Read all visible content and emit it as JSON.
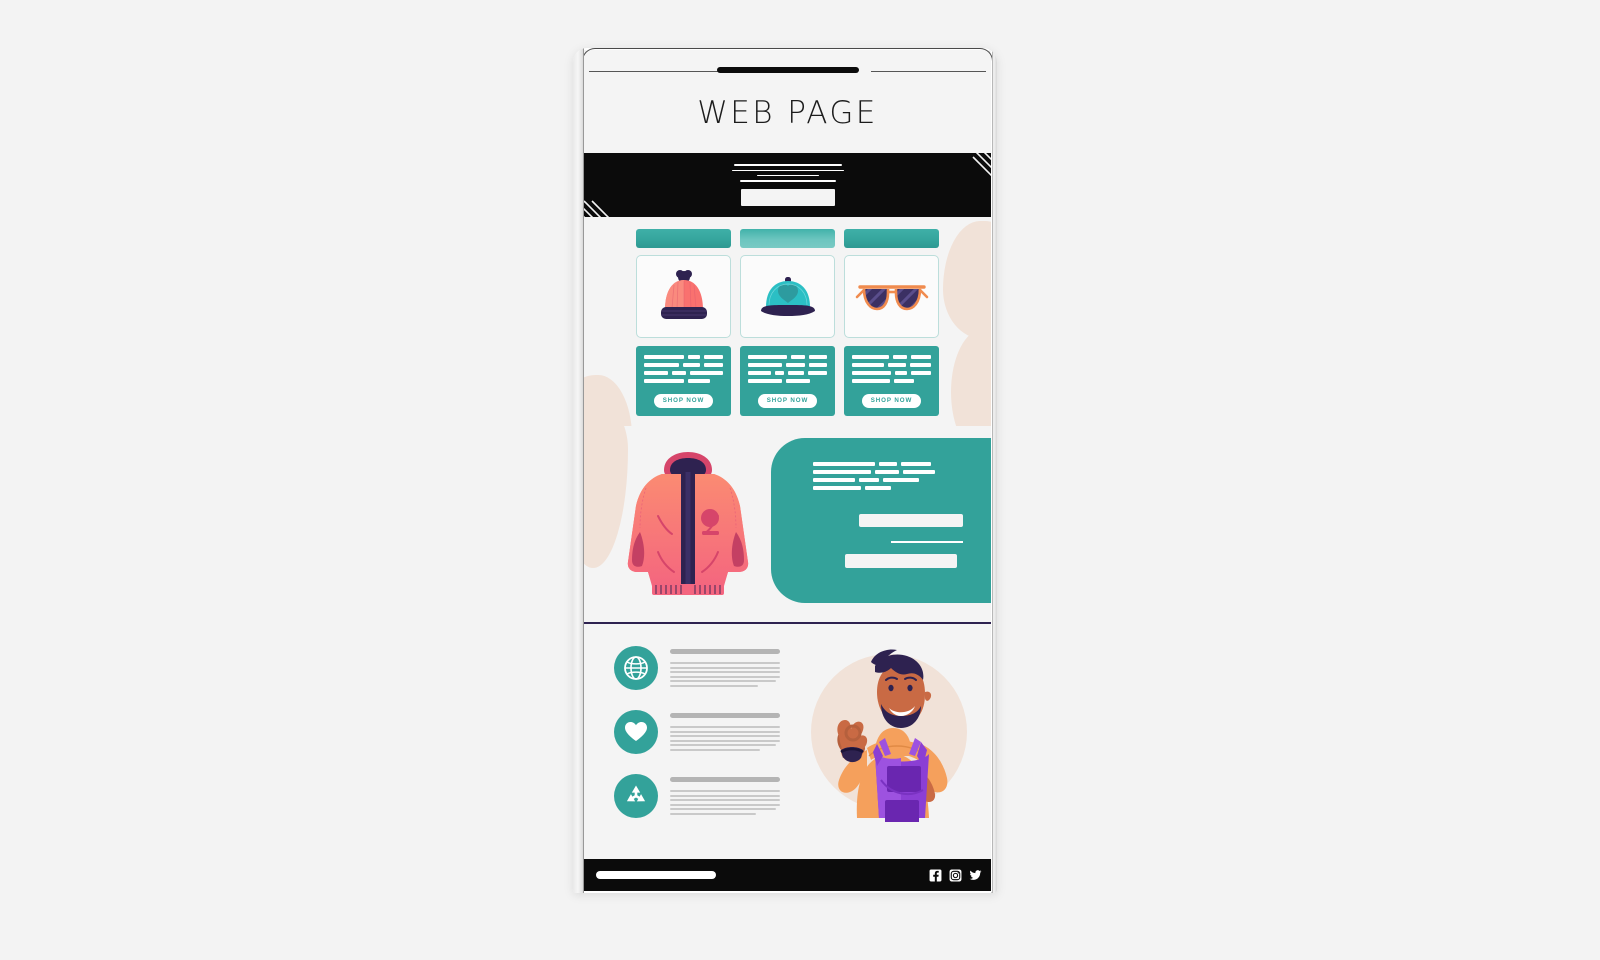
{
  "device": {
    "frame": "phone-mockup",
    "speaker_label": "speaker-grille"
  },
  "header": {
    "title": "WEB PAGE"
  },
  "hero": {
    "background_color": "#0b0b0b",
    "text_lines": [
      108,
      112,
      62,
      96
    ],
    "cta_label": "",
    "decoration": "diagonal-stripes"
  },
  "theme": {
    "teal": "#33a29a",
    "teal_light": "#79cac4",
    "beige_blob": "#f1e2d8",
    "navy": "#2e2250",
    "coral": "#f9716f",
    "black": "#0b0b0b",
    "screen_bg": "#f4f4f4"
  },
  "products": {
    "items": [
      {
        "id": "beanie",
        "header_state": "default",
        "image_name": "winter-beanie-hat",
        "text_rows": [
          [
            46,
            14,
            22
          ],
          [
            40,
            20,
            22
          ],
          [
            28,
            16,
            38
          ],
          [
            40,
            22
          ]
        ],
        "shop_label": "SHOP NOW"
      },
      {
        "id": "cap",
        "header_state": "highlighted",
        "image_name": "baseball-cap",
        "text_rows": [
          [
            44,
            16,
            20
          ],
          [
            38,
            22,
            20
          ],
          [
            26,
            10,
            18,
            22
          ],
          [
            34,
            24
          ]
        ],
        "shop_label": "SHOP NOW"
      },
      {
        "id": "sunglasses",
        "header_state": "default",
        "image_name": "aviator-sunglasses",
        "text_rows": [
          [
            42,
            16,
            22
          ],
          [
            36,
            20,
            24
          ],
          [
            44,
            14,
            22
          ],
          [
            38,
            20
          ]
        ],
        "shop_label": "SHOP NOW"
      }
    ]
  },
  "promo": {
    "image_name": "pink-puffer-jacket",
    "panel_color": "#33a29a",
    "text_rows": [
      [
        62,
        18,
        30
      ],
      [
        58,
        24,
        32
      ],
      [
        42,
        20,
        36
      ],
      [
        48,
        26
      ]
    ],
    "field_primary": "",
    "field_secondary": ""
  },
  "features": {
    "items": [
      {
        "icon": "globe-icon",
        "title_width": 110,
        "sub_line_count": 6
      },
      {
        "icon": "heart-icon",
        "title_width": 110,
        "sub_line_count": 6
      },
      {
        "icon": "recycle-icon",
        "title_width": 110,
        "sub_line_count": 6
      }
    ],
    "illustration_name": "bearded-man-in-purple-apron-waving-ok"
  },
  "footer": {
    "background_color": "#0b0b0b",
    "logo_label": "",
    "social": [
      {
        "name": "facebook-icon"
      },
      {
        "name": "instagram-icon"
      },
      {
        "name": "twitter-icon"
      }
    ]
  }
}
